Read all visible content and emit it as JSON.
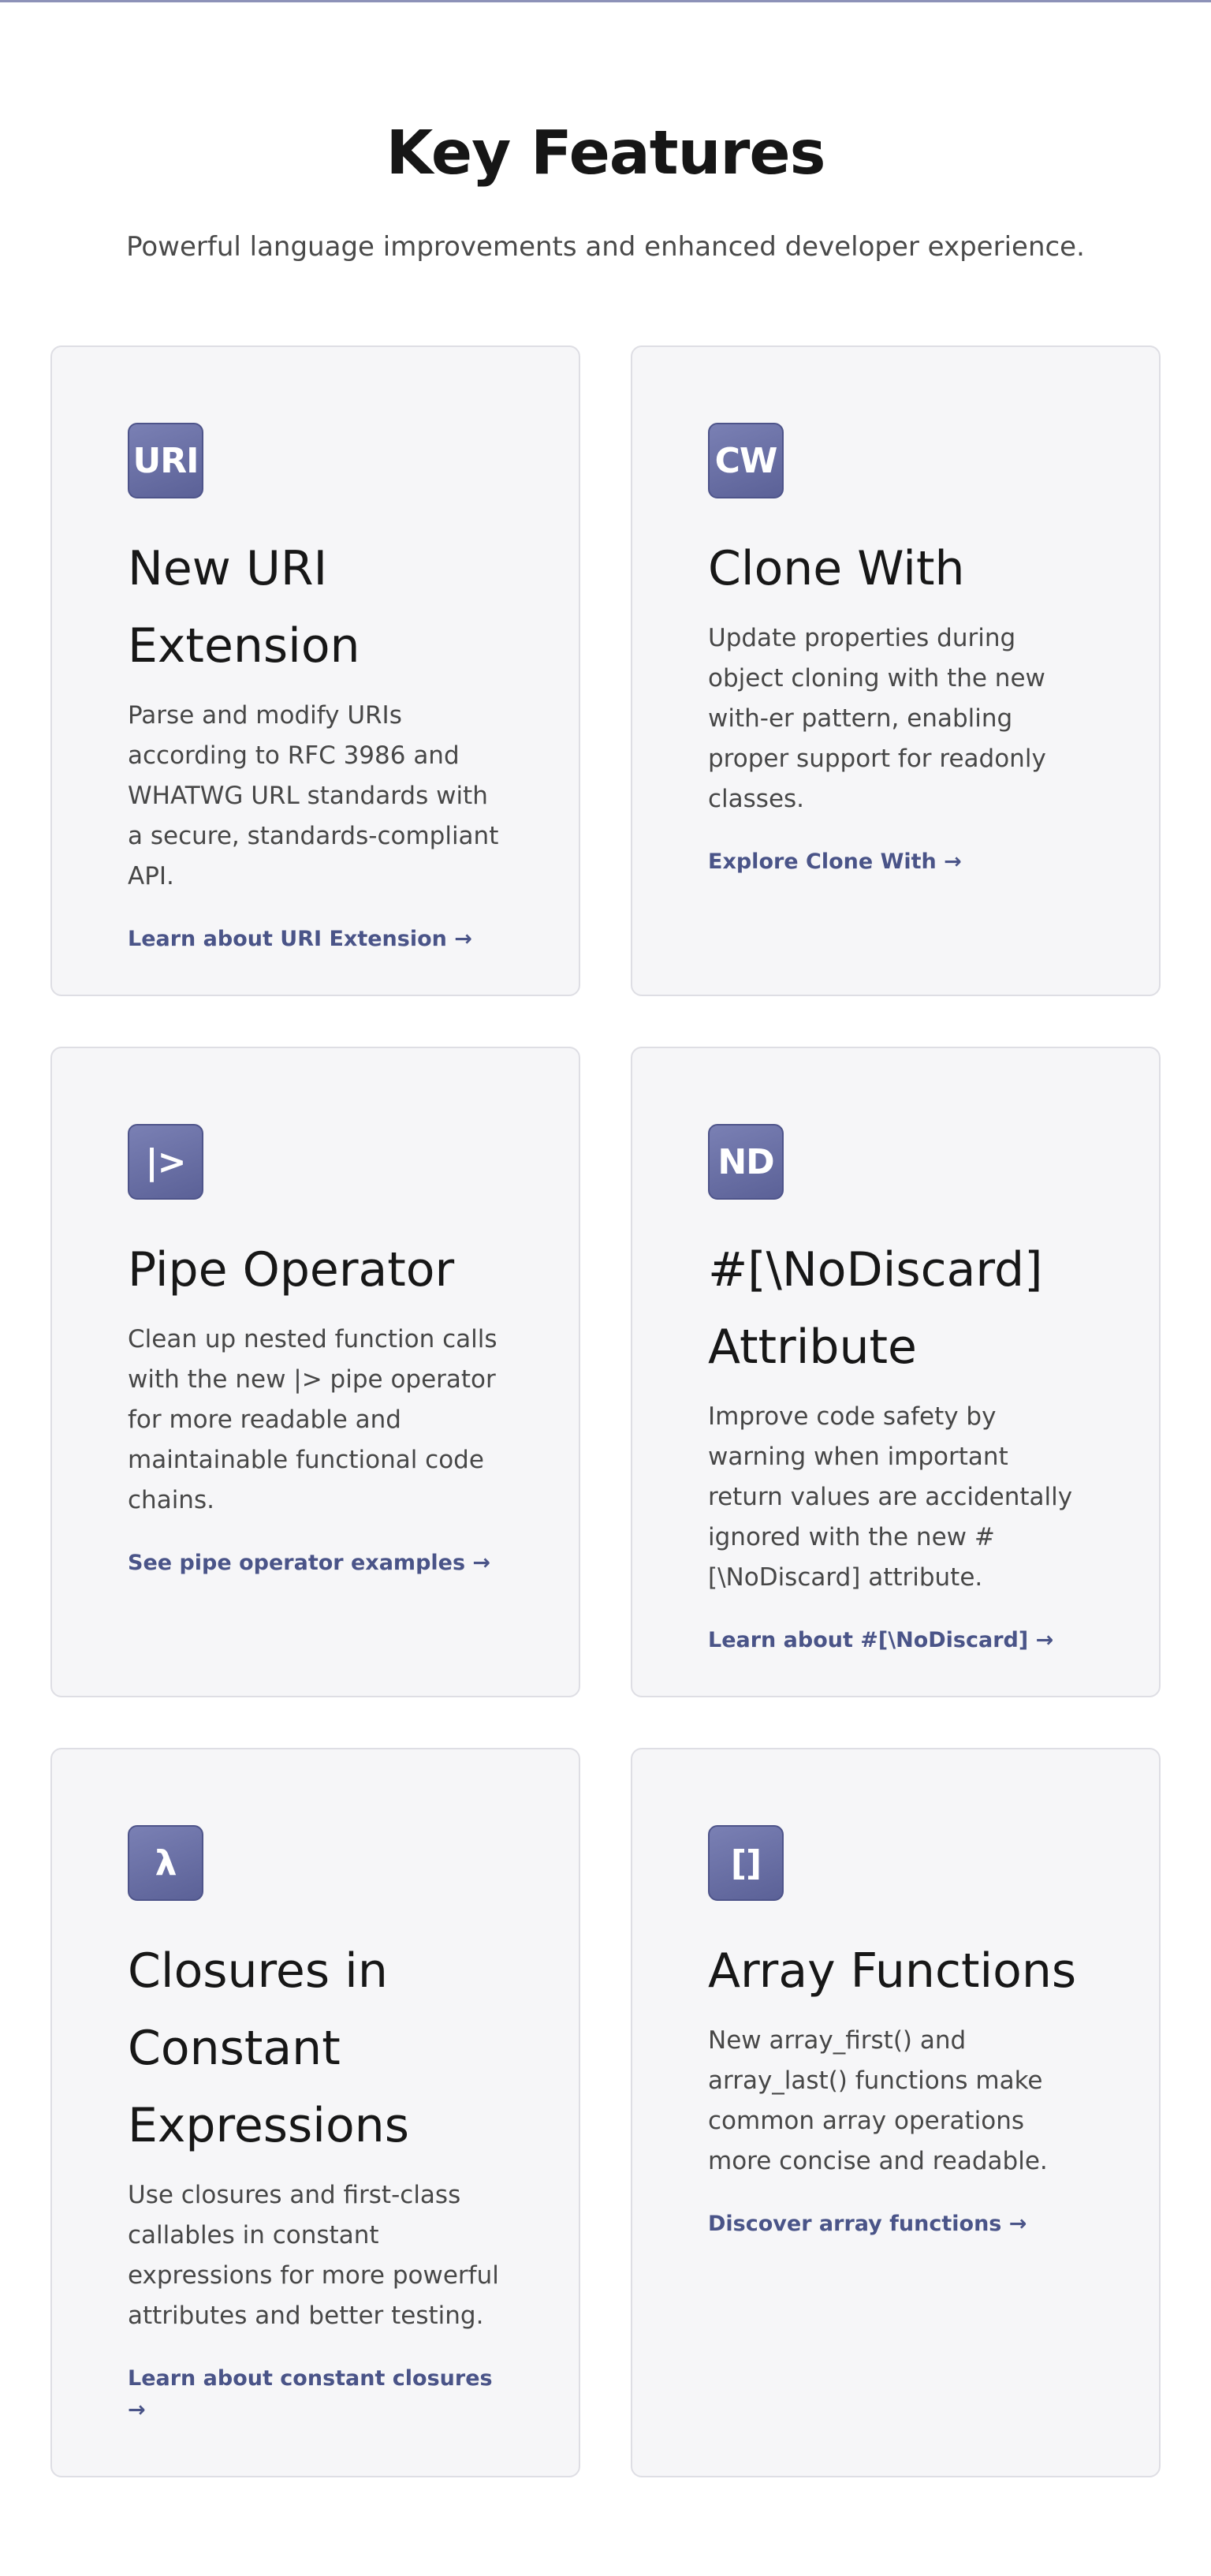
{
  "section": {
    "title": "Key Features",
    "subtitle": "Powerful language improvements and enhanced developer experience."
  },
  "colors": {
    "accent": "#4a5488",
    "icon_bg": "#6a70a6",
    "card_bg": "#f6f6f8"
  },
  "features": [
    {
      "icon": "URI",
      "title": "New URI Extension",
      "description": "Parse and modify URIs according to RFC 3986 and WHATWG URL standards with a secure, standards-compliant API.",
      "link": "Learn about URI Extension →"
    },
    {
      "icon": "CW",
      "title": "Clone With",
      "description": "Update properties during object cloning with the new with-er pattern, enabling proper support for readonly classes.",
      "link": "Explore Clone With →"
    },
    {
      "icon": "|>",
      "title": "Pipe Operator",
      "description": "Clean up nested function calls with the new |> pipe operator for more readable and maintainable functional code chains.",
      "link": "See pipe operator examples →"
    },
    {
      "icon": "ND",
      "title": "#[\\NoDiscard] Attribute",
      "description": "Improve code safety by warning when important return values are accidentally ignored with the new #[\\NoDiscard] attribute.",
      "link": "Learn about #[\\NoDiscard] →"
    },
    {
      "icon": "λ",
      "title": "Closures in Constant Expressions",
      "description": "Use closures and first-class callables in constant expressions for more powerful attributes and better testing.",
      "link": "Learn about constant closures →"
    },
    {
      "icon": "[]",
      "title": "Array Functions",
      "description": "New array_first() and array_last() functions make common array operations more concise and readable.",
      "link": "Discover array functions →"
    }
  ]
}
